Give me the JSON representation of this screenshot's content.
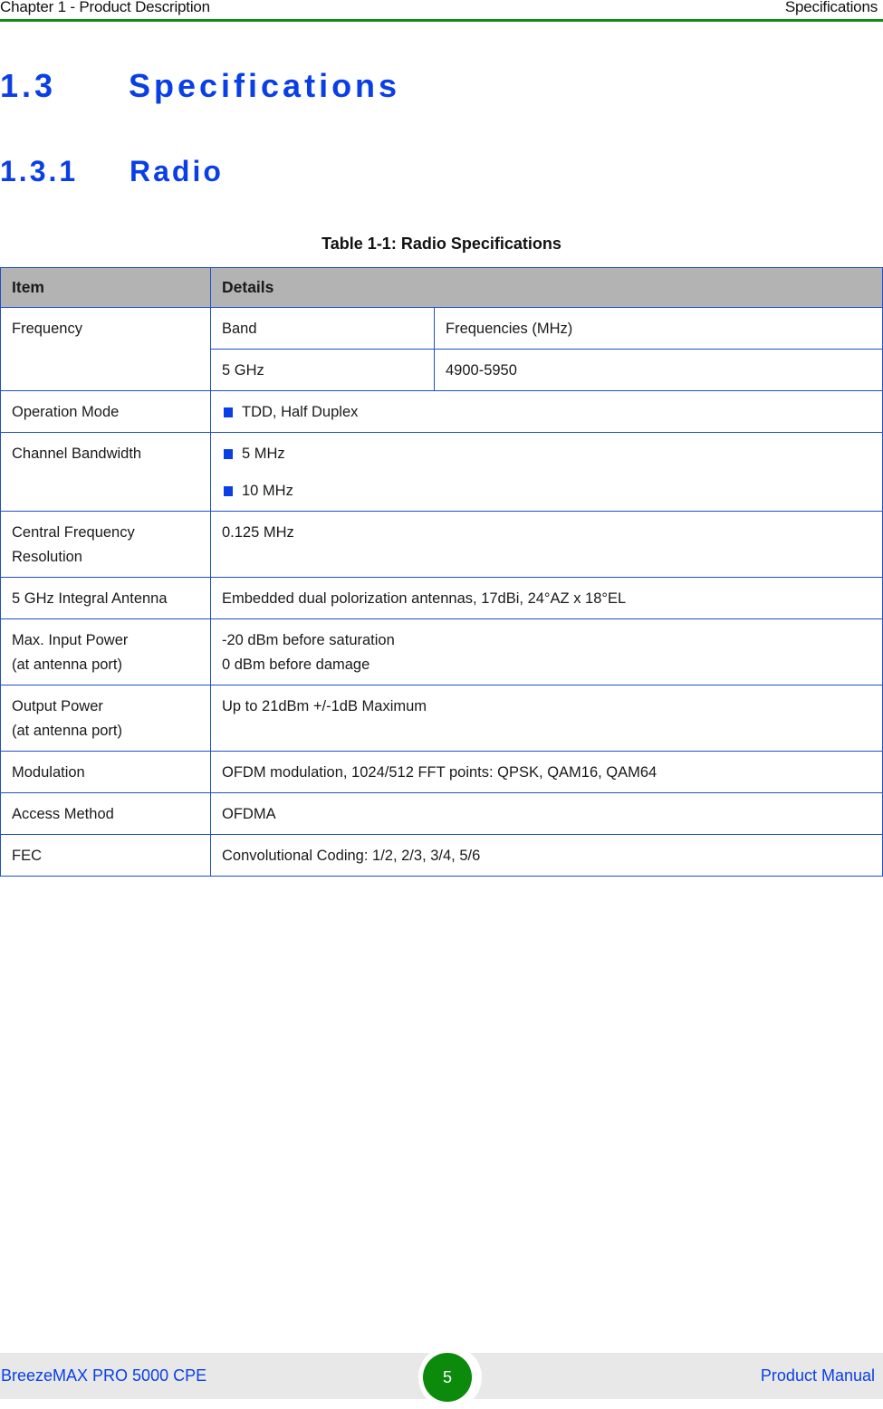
{
  "header": {
    "chapter": "Chapter 1 - Product Description",
    "section": "Specifications"
  },
  "headings": {
    "h1_number": "1.3",
    "h1_title": "Specifications",
    "h2_number": "1.3.1",
    "h2_title": "Radio"
  },
  "table": {
    "caption": "Table 1-1: Radio Specifications",
    "columns": [
      "Item",
      "Details"
    ],
    "frequency": {
      "item": "Frequency",
      "sub_headers": [
        "Band",
        "Frequencies (MHz)"
      ],
      "sub_values": [
        "5 GHz",
        "4900-5950"
      ]
    },
    "rows": [
      {
        "item": "Operation Mode",
        "bullets": [
          "TDD, Half Duplex"
        ]
      },
      {
        "item": "Channel Bandwidth",
        "bullets": [
          "5 MHz",
          "10 MHz"
        ]
      },
      {
        "item": "Central Frequency Resolution",
        "details": "0.125 MHz"
      },
      {
        "item": "5 GHz Integral Antenna",
        "details": "Embedded dual polorization antennas, 17dBi, 24°AZ x 18°EL"
      },
      {
        "item_lines": [
          "Max. Input Power",
          "(at antenna port)"
        ],
        "detail_lines": [
          "-20 dBm before saturation",
          "0 dBm before damage"
        ]
      },
      {
        "item_lines": [
          "Output Power",
          "(at antenna port)"
        ],
        "details": "Up to 21dBm +/-1dB Maximum"
      },
      {
        "item": "Modulation",
        "details": "OFDM modulation, 1024/512 FFT points: QPSK, QAM16, QAM64"
      },
      {
        "item": "Access Method",
        "details": "OFDMA"
      },
      {
        "item": "FEC",
        "details": "Convolutional Coding: 1/2, 2/3, 3/4, 5/6"
      }
    ]
  },
  "footer": {
    "product": "BreezeMAX PRO 5000 CPE",
    "page_number": "5",
    "doc_type": "Product Manual"
  },
  "colors": {
    "heading_blue": "#0a3fe6",
    "header_rule_green": "#138a13",
    "table_border_blue": "#1e4fc8",
    "table_header_gray": "#b3b3b3",
    "page_badge_green": "#0b8a0b"
  }
}
